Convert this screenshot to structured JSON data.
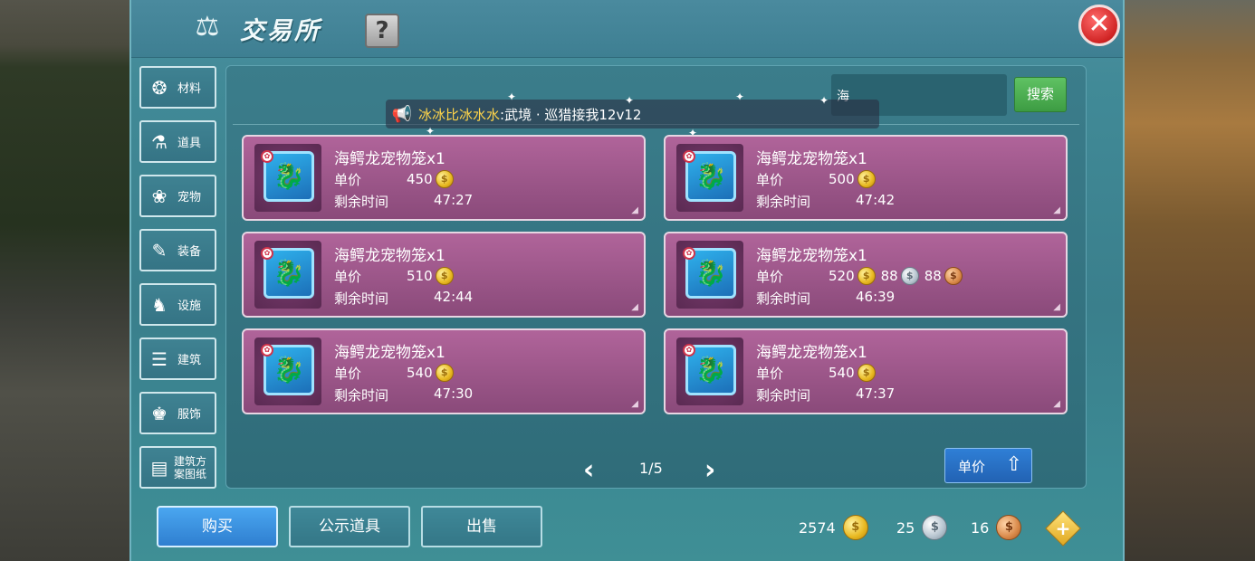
{
  "window": {
    "title": "交易所",
    "help_label": "?",
    "close_label": "✕"
  },
  "sidebar": {
    "items": [
      {
        "label": "材料",
        "icon": "materials-icon",
        "glyph": "❂"
      },
      {
        "label": "道具",
        "icon": "props-icon",
        "glyph": "⚗"
      },
      {
        "label": "宠物",
        "icon": "paw-icon",
        "glyph": "❀"
      },
      {
        "label": "装备",
        "icon": "equipment-icon",
        "glyph": "✎"
      },
      {
        "label": "设施",
        "icon": "facility-icon",
        "glyph": "♞"
      },
      {
        "label": "建筑",
        "icon": "building-icon",
        "glyph": "☰"
      },
      {
        "label": "服饰",
        "icon": "clothing-icon",
        "glyph": "♚"
      },
      {
        "label": "建筑方\n案图纸",
        "icon": "blueprint-icon",
        "glyph": "▤"
      }
    ]
  },
  "search": {
    "value": "海",
    "button_label": "搜索"
  },
  "broadcast": {
    "sender": "冰冰比冰水水",
    "message": ":武境 · 巡猎接我12v12"
  },
  "listings": [
    {
      "name": "海鳄龙宠物笼x1",
      "price_label": "单价",
      "gold": "450",
      "time_label": "剩余时间",
      "time": "47:27"
    },
    {
      "name": "海鳄龙宠物笼x1",
      "price_label": "单价",
      "gold": "500",
      "time_label": "剩余时间",
      "time": "47:42"
    },
    {
      "name": "海鳄龙宠物笼x1",
      "price_label": "单价",
      "gold": "510",
      "time_label": "剩余时间",
      "time": "42:44"
    },
    {
      "name": "海鳄龙宠物笼x1",
      "price_label": "单价",
      "gold": "520",
      "silver": "88",
      "bronze": "88",
      "time_label": "剩余时间",
      "time": "46:39"
    },
    {
      "name": "海鳄龙宠物笼x1",
      "price_label": "单价",
      "gold": "540",
      "time_label": "剩余时间",
      "time": "47:30"
    },
    {
      "name": "海鳄龙宠物笼x1",
      "price_label": "单价",
      "gold": "540",
      "time_label": "剩余时间",
      "time": "47:37"
    }
  ],
  "pagination": {
    "current": "1/5",
    "prev": "‹",
    "next": "›"
  },
  "sort": {
    "label": "单价",
    "icon": "sort-arrow-icon"
  },
  "bottom_tabs": {
    "buy": "购买",
    "public": "公示道具",
    "sell": "出售"
  },
  "wallet": {
    "gold": "2574",
    "silver": "25",
    "bronze": "16",
    "add_label": "+"
  },
  "colors": {
    "panel": "#3f8a97",
    "card": "#9c5a8c",
    "search_button": "#4fae54",
    "buy_tab": "#3a92e0",
    "close_button": "#d02424"
  }
}
